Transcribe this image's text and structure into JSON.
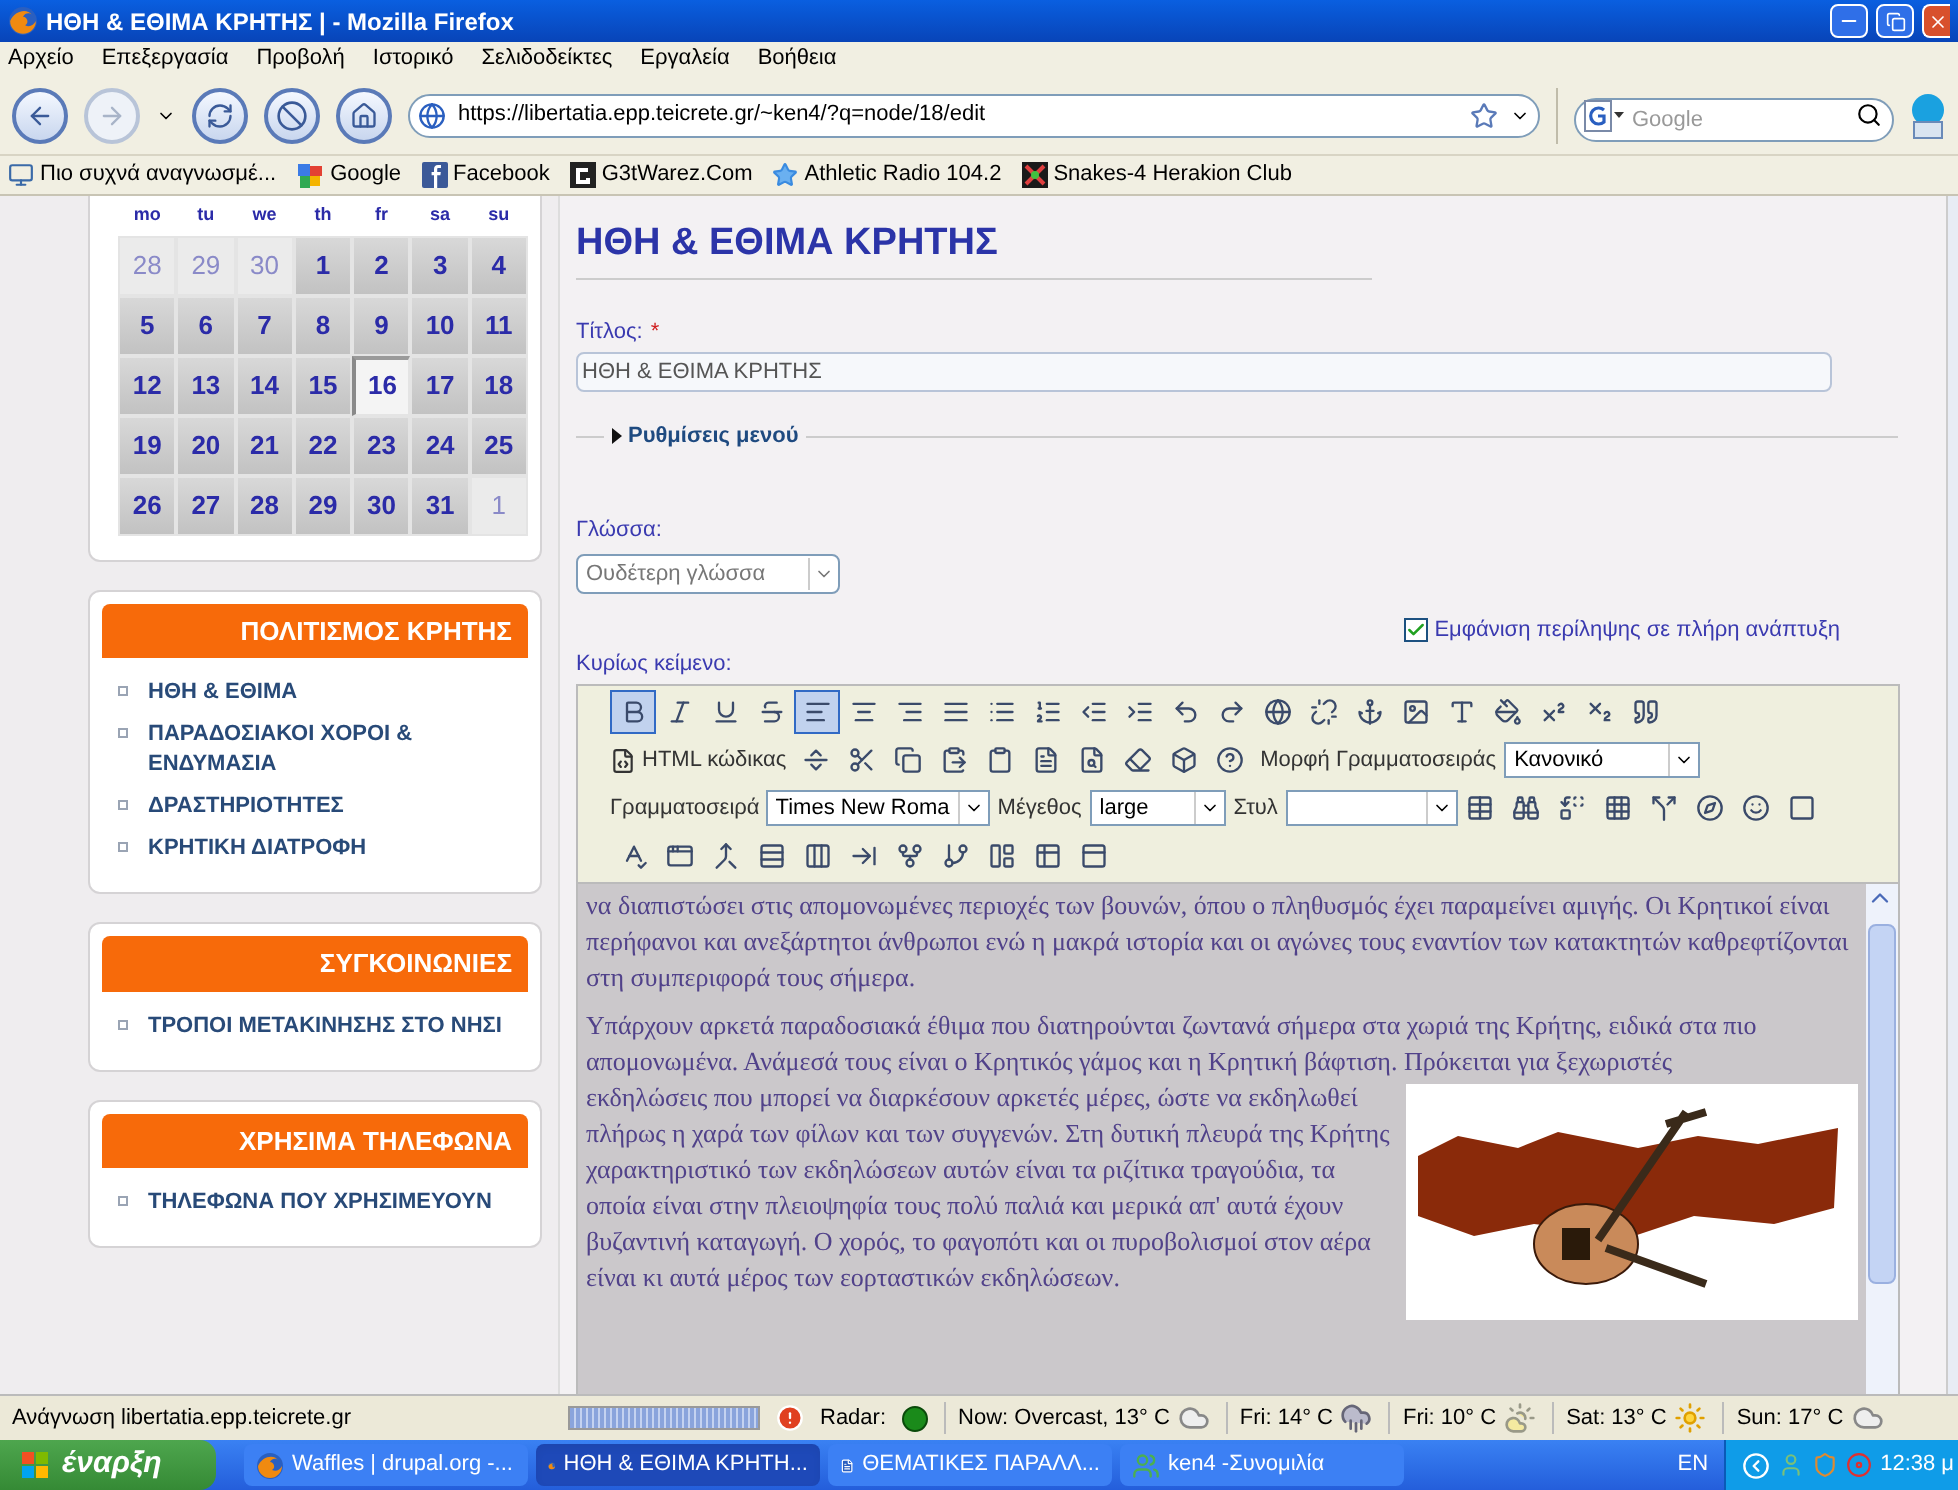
{
  "window": {
    "title": "ΗΘΗ & ΕΘΙΜΑ ΚΡΗΤΗΣ | - Mozilla Firefox"
  },
  "menu": [
    "Αρχείο",
    "Επεξεργασία",
    "Προβολή",
    "Ιστορικό",
    "Σελιδοδείκτες",
    "Εργαλεία",
    "Βοήθεια"
  ],
  "address_bar": {
    "url": "https://libertatia.epp.teicrete.gr/~ken4/?q=node/18/edit"
  },
  "search": {
    "placeholder": "Google"
  },
  "bookmarks": [
    {
      "kind": "monitor",
      "label": "Πιο συχνά αναγνωσμέ..."
    },
    {
      "kind": "google",
      "label": "Google"
    },
    {
      "kind": "facebook",
      "label": "Facebook"
    },
    {
      "kind": "g3",
      "label": "G3tWarez.Com"
    },
    {
      "kind": "star",
      "label": "Athletic Radio 104.2"
    },
    {
      "kind": "snakes",
      "label": "Snakes-4 Herakion Club"
    }
  ],
  "calendar": {
    "weekdays": [
      "mo",
      "tu",
      "we",
      "th",
      "fr",
      "sa",
      "su"
    ],
    "days": [
      {
        "label": "28",
        "muted": true,
        "selected": false
      },
      {
        "label": "29",
        "muted": true,
        "selected": false
      },
      {
        "label": "30",
        "muted": true,
        "selected": false
      },
      {
        "label": "1",
        "muted": false,
        "selected": false
      },
      {
        "label": "2",
        "muted": false,
        "selected": false
      },
      {
        "label": "3",
        "muted": false,
        "selected": false
      },
      {
        "label": "4",
        "muted": false,
        "selected": false
      },
      {
        "label": "5",
        "muted": false,
        "selected": false
      },
      {
        "label": "6",
        "muted": false,
        "selected": false
      },
      {
        "label": "7",
        "muted": false,
        "selected": false
      },
      {
        "label": "8",
        "muted": false,
        "selected": false
      },
      {
        "label": "9",
        "muted": false,
        "selected": false
      },
      {
        "label": "10",
        "muted": false,
        "selected": false
      },
      {
        "label": "11",
        "muted": false,
        "selected": false
      },
      {
        "label": "12",
        "muted": false,
        "selected": false
      },
      {
        "label": "13",
        "muted": false,
        "selected": false
      },
      {
        "label": "14",
        "muted": false,
        "selected": false
      },
      {
        "label": "15",
        "muted": false,
        "selected": false
      },
      {
        "label": "16",
        "muted": false,
        "selected": true
      },
      {
        "label": "17",
        "muted": false,
        "selected": false
      },
      {
        "label": "18",
        "muted": false,
        "selected": false
      },
      {
        "label": "19",
        "muted": false,
        "selected": false
      },
      {
        "label": "20",
        "muted": false,
        "selected": false
      },
      {
        "label": "21",
        "muted": false,
        "selected": false
      },
      {
        "label": "22",
        "muted": false,
        "selected": false
      },
      {
        "label": "23",
        "muted": false,
        "selected": false
      },
      {
        "label": "24",
        "muted": false,
        "selected": false
      },
      {
        "label": "25",
        "muted": false,
        "selected": false
      },
      {
        "label": "26",
        "muted": false,
        "selected": false
      },
      {
        "label": "27",
        "muted": false,
        "selected": false
      },
      {
        "label": "28",
        "muted": false,
        "selected": false
      },
      {
        "label": "29",
        "muted": false,
        "selected": false
      },
      {
        "label": "30",
        "muted": false,
        "selected": false
      },
      {
        "label": "31",
        "muted": false,
        "selected": false
      },
      {
        "label": "1",
        "muted": true,
        "selected": false
      }
    ]
  },
  "sidebar_blocks": [
    {
      "title": "ΠΟΛΙΤΙΣΜΟΣ ΚΡΗΤΗΣ",
      "items": [
        "ΗΘΗ & ΕΘΙΜΑ",
        "ΠΑΡΑΔΟΣΙΑΚΟΙ ΧΟΡΟΙ & ΕΝΔΥΜΑΣΙΑ",
        "ΔΡΑΣΤΗΡΙΟΤΗΤΕΣ",
        "ΚΡΗΤΙΚΗ ΔΙΑΤΡΟΦΗ"
      ]
    },
    {
      "title": "ΣΥΓΚΟΙΝΩΝΙΕΣ",
      "items": [
        "ΤΡΟΠΟΙ ΜΕΤΑΚΙΝΗΣΗΣ ΣΤΟ ΝΗΣΙ"
      ]
    },
    {
      "title": "ΧΡΗΣΙΜΑ ΤΗΛΕΦΩΝΑ",
      "items": [
        "ΤΗΛΕΦΩΝΑ ΠΟΥ ΧΡΗΣΙΜΕΥΟΥΝ"
      ]
    }
  ],
  "page": {
    "heading": "ΗΘΗ & ΕΘΙΜΑ ΚΡΗΤΗΣ",
    "title_field": {
      "label": "Τίτλος:",
      "required_mark": "*",
      "value": "ΗΘΗ & ΕΘΙΜΑ ΚΡΗΤΗΣ"
    },
    "menu_settings": {
      "label": "Ρυθμίσεις μενού",
      "expanded": false
    },
    "language": {
      "label": "Γλώσσα:",
      "value": "Ουδέτερη γλώσσα"
    },
    "summary_checkbox": {
      "label": "Εμφάνιση περίληψης σε πλήρη ανάπτυξη",
      "checked": true
    },
    "body_label": "Κυρίως κείμενο:"
  },
  "editor": {
    "row_1": [
      {
        "kind": "bold",
        "selected": true
      },
      {
        "kind": "italic",
        "selected": false
      },
      {
        "kind": "underline",
        "selected": false
      },
      {
        "kind": "strike",
        "selected": false
      },
      {
        "kind": "align-left",
        "selected": true
      },
      {
        "kind": "align-center",
        "selected": false
      },
      {
        "kind": "align-right",
        "selected": false
      },
      {
        "kind": "justify",
        "selected": false
      },
      {
        "kind": "bullets",
        "selected": false
      },
      {
        "kind": "numbers",
        "selected": false
      },
      {
        "kind": "outdent",
        "selected": false
      },
      {
        "kind": "indent",
        "selected": false
      },
      {
        "kind": "undo",
        "selected": false
      },
      {
        "kind": "redo",
        "selected": false
      },
      {
        "kind": "link",
        "selected": false
      },
      {
        "kind": "unlink",
        "selected": false
      },
      {
        "kind": "anchor",
        "selected": false
      },
      {
        "kind": "image",
        "selected": false
      },
      {
        "kind": "text-color",
        "selected": false
      },
      {
        "kind": "bg-color",
        "selected": false
      },
      {
        "kind": "sup",
        "selected": false
      },
      {
        "kind": "sub",
        "selected": false
      },
      {
        "kind": "quote",
        "selected": false
      }
    ],
    "html_button": "HTML κώδικας",
    "row_2": [
      {
        "kind": "rule",
        "selected": false
      },
      {
        "kind": "cut",
        "selected": false
      },
      {
        "kind": "copy",
        "selected": false
      },
      {
        "kind": "paste",
        "selected": false
      },
      {
        "kind": "paste-text",
        "selected": false
      },
      {
        "kind": "paste-word",
        "selected": false
      },
      {
        "kind": "preview",
        "selected": false
      },
      {
        "kind": "eraser",
        "selected": false
      },
      {
        "kind": "cube",
        "selected": false
      },
      {
        "kind": "help",
        "selected": false
      }
    ],
    "format": {
      "label": "Μορφή Γραμματοσειράς",
      "value": "Κανονικό"
    },
    "font": {
      "label": "Γραμματοσειρά",
      "value": "Times New Roma"
    },
    "size": {
      "label": "Μέγεθος",
      "value": "large"
    },
    "style": {
      "label": "Στυλ"
    },
    "row_3": [
      {
        "kind": "table",
        "selected": false
      },
      {
        "kind": "find",
        "selected": false
      },
      {
        "kind": "replace",
        "selected": false
      },
      {
        "kind": "grid",
        "selected": false
      },
      {
        "kind": "split",
        "selected": false
      },
      {
        "kind": "flash",
        "selected": false
      },
      {
        "kind": "smiley",
        "selected": false
      },
      {
        "kind": "box",
        "selected": false
      }
    ],
    "row_4": [
      {
        "kind": "spell",
        "selected": false
      },
      {
        "kind": "window",
        "selected": false
      },
      {
        "kind": "merge",
        "selected": false
      },
      {
        "kind": "rows",
        "selected": false
      },
      {
        "kind": "columns",
        "selected": false
      },
      {
        "kind": "row-after",
        "selected": false
      },
      {
        "kind": "col-split",
        "selected": false
      },
      {
        "kind": "row-split",
        "selected": false
      },
      {
        "kind": "cell",
        "selected": false
      },
      {
        "kind": "table2",
        "selected": false
      },
      {
        "kind": "table3",
        "selected": false
      }
    ],
    "paragraphs": [
      "να διαπιστώσει στις απομονωμένες περιοχές των βουνών, όπου ο πληθυσμός έχει παραμείνει αμιγής. Οι Κρητικοί είναι περήφανοι και ανεξάρτητοι άνθρωποι ενώ η μακρά ιστορία και οι αγώνες τους εναντίον των κατακτητών καθρεφτίζονται στη συμπεριφορά τους σήμερα.",
      "Υπάρχουν αρκετά παραδοσιακά έθιμα που διατηρούνται ζωντανά σήμερα στα χωριά της Κρήτης, ειδικά στα πιο απομονωμένα. Ανάμεσά τους είναι ο Κρητικός γάμος και η Κρητική βάφτιση. Πρόκειται για ξεχωριστές",
      "εκδηλώσεις που μπορεί να διαρκέσουν αρκετές μέρες, ώστε να εκδηλωθεί πλήρως η χαρά των φίλων και των συγγενών. Στη δυτική πλευρά της Κρήτης χαρακτηριστικό των εκδηλώσεων αυτών είναι τα ριζίτικα τραγούδια, τα οποία είναι στην πλειοψηφία τους πολύ παλιά και μερικά απ' αυτά έχουν βυζαντινή καταγωγή. Ο χορός, το φαγοπότι και οι πυροβολισμοί στον αέρα είναι κι αυτά μέρος των εορταστικών εκδηλώσεων."
    ]
  },
  "status_bar": {
    "text": "Ανάγνωση libertatia.epp.teicrete.gr",
    "level": 1,
    "radar": "Radar:",
    "weather": [
      {
        "kind": "cloud",
        "label": "Now: Overcast, 13° C"
      },
      {
        "kind": "rain",
        "label": "Fri: 14° C"
      },
      {
        "kind": "partly",
        "label": "Fri: 10° C"
      },
      {
        "kind": "sun",
        "label": "Sat: 13° C"
      },
      {
        "kind": "cloud",
        "label": "Sun: 17° C"
      }
    ]
  },
  "taskbar": {
    "start": "έναρξη",
    "tasks": [
      {
        "kind": "firefox",
        "label": "Waffles | drupal.org -...",
        "selected": false
      },
      {
        "kind": "firefox",
        "label": "ΗΘΗ & ΕΘΙΜΑ ΚΡΗΤΗ...",
        "selected": true
      },
      {
        "kind": "word",
        "label": "ΘΕΜΑΤΙΚΕΣ ΠΑΡΑΛΛ...",
        "selected": false
      },
      {
        "kind": "messenger",
        "label": "ken4 -Συνομιλία",
        "selected": false
      }
    ],
    "language": "EN",
    "clock": "12:38 μ"
  }
}
